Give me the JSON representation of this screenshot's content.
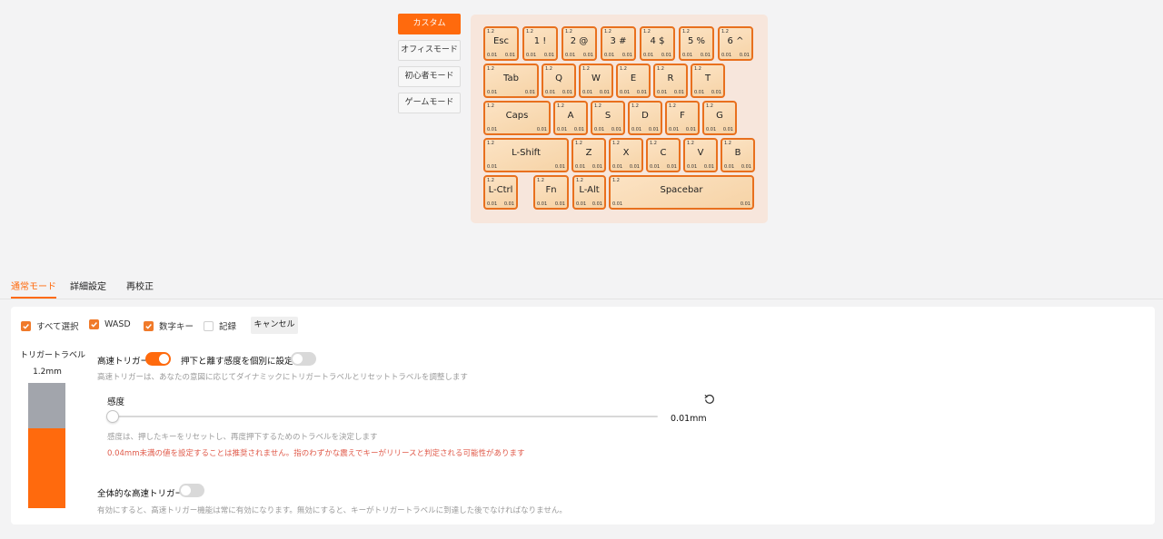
{
  "modes": [
    "カスタム",
    "オフィスモード",
    "初心者モード",
    "ゲームモード"
  ],
  "keyboard": {
    "rows": [
      [
        {
          "label": "Esc",
          "top": "1.2",
          "bl": "0.01",
          "br": "0.01"
        },
        {
          "label": "1 !",
          "top": "1.2",
          "bl": "0.01",
          "br": "0.01"
        },
        {
          "label": "2 @",
          "top": "1.2",
          "bl": "0.01",
          "br": "0.01"
        },
        {
          "label": "3 #",
          "top": "1.2",
          "bl": "0.01",
          "br": "0.01"
        },
        {
          "label": "4 $",
          "top": "1.2",
          "bl": "0.01",
          "br": "0.01"
        },
        {
          "label": "5 %",
          "top": "1.2",
          "bl": "0.01",
          "br": "0.01"
        },
        {
          "label": "6 ^",
          "top": "1.2",
          "bl": "0.01",
          "br": "0.01"
        }
      ],
      [
        {
          "label": "Tab",
          "top": "1.2",
          "bl": "0.01",
          "br": "0.01"
        },
        {
          "label": "Q",
          "top": "1.2",
          "bl": "0.01",
          "br": "0.01"
        },
        {
          "label": "W",
          "top": "1.2",
          "bl": "0.01",
          "br": "0.01"
        },
        {
          "label": "E",
          "top": "1.2",
          "bl": "0.01",
          "br": "0.01"
        },
        {
          "label": "R",
          "top": "1.2",
          "bl": "0.01",
          "br": "0.01"
        },
        {
          "label": "T",
          "top": "1.2",
          "bl": "0.01",
          "br": "0.01"
        }
      ],
      [
        {
          "label": "Caps",
          "top": "1.2",
          "bl": "0.01",
          "br": "0.01"
        },
        {
          "label": "A",
          "top": "1.2",
          "bl": "0.01",
          "br": "0.01"
        },
        {
          "label": "S",
          "top": "1.2",
          "bl": "0.01",
          "br": "0.01"
        },
        {
          "label": "D",
          "top": "1.2",
          "bl": "0.01",
          "br": "0.01"
        },
        {
          "label": "F",
          "top": "1.2",
          "bl": "0.01",
          "br": "0.01"
        },
        {
          "label": "G",
          "top": "1.2",
          "bl": "0.01",
          "br": "0.01"
        }
      ],
      [
        {
          "label": "L-Shift",
          "top": "1.2",
          "bl": "0.01",
          "br": "0.01"
        },
        {
          "label": "Z",
          "top": "1.2",
          "bl": "0.01",
          "br": "0.01"
        },
        {
          "label": "X",
          "top": "1.2",
          "bl": "0.01",
          "br": "0.01"
        },
        {
          "label": "C",
          "top": "1.2",
          "bl": "0.01",
          "br": "0.01"
        },
        {
          "label": "V",
          "top": "1.2",
          "bl": "0.01",
          "br": "0.01"
        },
        {
          "label": "B",
          "top": "1.2",
          "bl": "0.01",
          "br": "0.01"
        }
      ],
      [
        {
          "label": "L-Ctrl",
          "top": "1.2",
          "bl": "0.01",
          "br": "0.01"
        },
        {
          "label": "Fn",
          "top": "1.2",
          "bl": "0.01",
          "br": "0.01"
        },
        {
          "label": "L-Alt",
          "top": "1.2",
          "bl": "0.01",
          "br": "0.01"
        },
        {
          "label": "Spacebar",
          "top": "1.2",
          "bl": "0.01",
          "br": "0.01"
        }
      ]
    ]
  },
  "tabs": [
    "通常モード",
    "詳細設定",
    "再校正"
  ],
  "selection": {
    "select_all": "すべて選択",
    "wasd": "WASD",
    "number_keys": "数字キー",
    "record": "記録",
    "cancel": "キャンセル"
  },
  "trigger_travel": {
    "label": "トリガートラベル",
    "value": "1.2mm",
    "fill_fraction": 0.64
  },
  "rapid_trigger": {
    "label": "高速トリガー",
    "enabled": true,
    "separate_label": "押下と離す感度を個別に設定",
    "separate_enabled": false,
    "description": "高速トリガーは、あなたの意図に応じてダイナミックにトリガートラベルとリセットトラベルを調整します"
  },
  "sensitivity": {
    "label": "感度",
    "value": "0.01mm",
    "position_fraction": 0.0,
    "hint": "感度は、押したキーをリセットし、再度押下するためのトラベルを決定します",
    "warning": "0.04mm未満の値を設定することは推奨されません。指のわずかな震えでキーがリリースと判定される可能性があります"
  },
  "global_rapid": {
    "label": "全体的な高速トリガー",
    "enabled": false,
    "description": "有効にすると、高速トリガー機能は常に有効になります。無効にすると、キーがトリガートラベルに到達した後でなければなりません。"
  },
  "colors": {
    "accent": "#ff6a0d",
    "key_border": "#e8701e",
    "warning": "#e05a4a"
  }
}
